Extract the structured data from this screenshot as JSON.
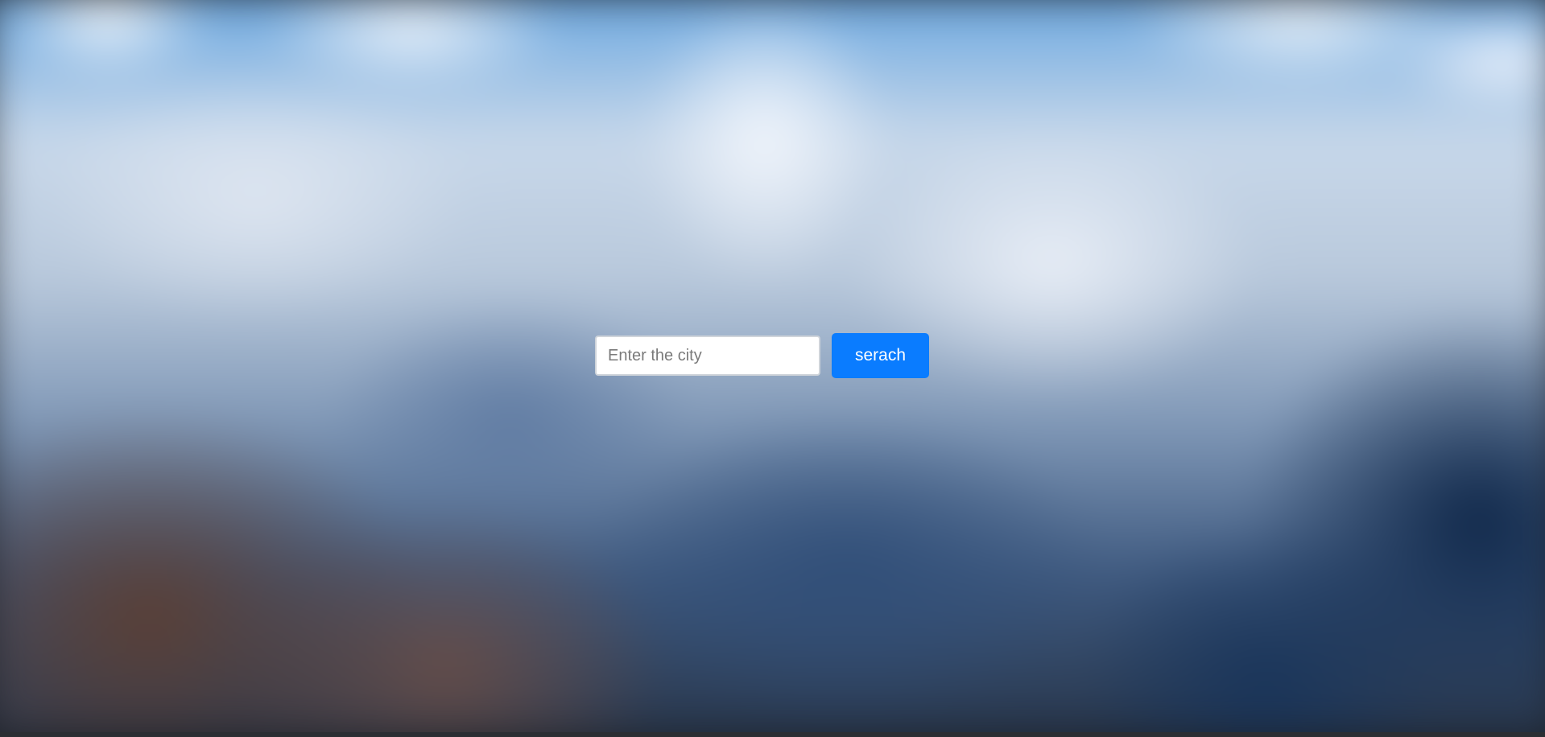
{
  "background": {
    "description_icon": "mountain-background-image",
    "accent_sky": "#6aa7e0",
    "accent_dark": "#1b1f26"
  },
  "search": {
    "placeholder": "Enter the city",
    "value": "",
    "button_label": "serach",
    "button_color": "#0a7cff"
  }
}
